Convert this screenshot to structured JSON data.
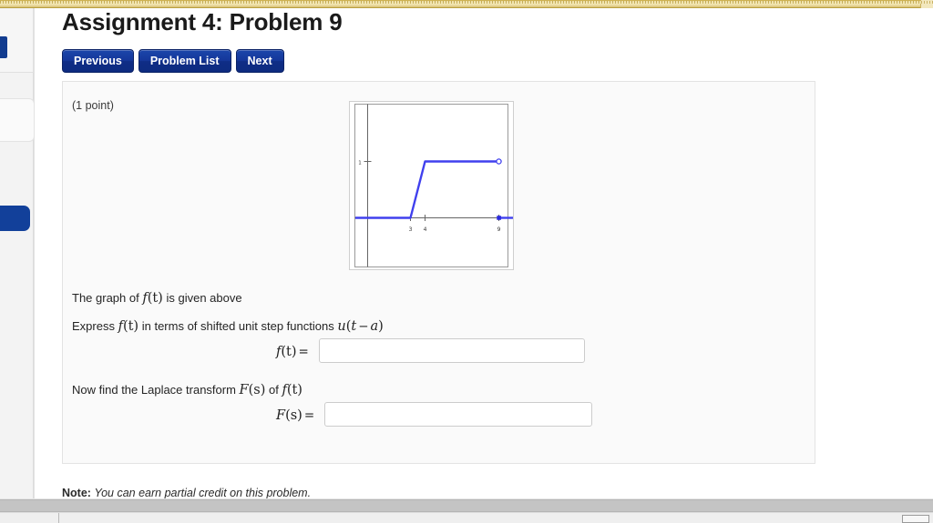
{
  "page": {
    "title": "Assignment 4: Problem 9",
    "points": "(1 point)",
    "note_label": "Note:",
    "note_text": "You can earn partial credit on this problem."
  },
  "nav": {
    "buttons": [
      {
        "label": "Previous",
        "name": "previous-button"
      },
      {
        "label": "Problem List",
        "name": "problem-list-button"
      },
      {
        "label": "Next",
        "name": "next-button"
      }
    ]
  },
  "prose": {
    "line1": {
      "pre": "The graph of ",
      "fn": "f",
      "fn_arg": "(t)",
      "post": " is given above"
    },
    "line2": {
      "pre": "Express ",
      "fn": "f",
      "fn_arg": "(t)",
      "mid": " in terms of shifted unit step functions ",
      "u": "u",
      "u_arg_open": "(",
      "u_var": "t",
      "u_minus": "−",
      "u_a": "a",
      "u_arg_close": ")"
    },
    "line3": {
      "pre": "Now find the Laplace transform ",
      "F": "F",
      "F_arg": "(s)",
      "mid": " of ",
      "fn": "f",
      "fn_arg": "(t)"
    }
  },
  "answers": [
    {
      "name": "f-of-t-answer",
      "label_fn": "f",
      "label_arg": "(t)",
      "label_eq": "=",
      "value": "",
      "placeholder": ""
    },
    {
      "name": "F-of-s-answer",
      "label_fn": "F",
      "label_arg": "(s)",
      "label_eq": "=",
      "value": "",
      "placeholder": ""
    }
  ],
  "colors": {
    "button_blue": "#12379a",
    "curve_blue": "#4040ee",
    "axis_gray": "#666666",
    "top_band_gold": "#e2cf83",
    "card_bg": "#fafafa"
  },
  "chart_data": {
    "type": "line",
    "title": "",
    "xlabel": "",
    "ylabel": "",
    "xlim": [
      -1.6,
      11.2
    ],
    "ylim": [
      -1.35,
      2.05
    ],
    "grid": false,
    "legend": null,
    "xticks": [
      3,
      4,
      9
    ],
    "xtick_labels": [
      "3",
      "4",
      "9"
    ],
    "yticks": [
      1
    ],
    "ytick_labels": [
      "1"
    ],
    "series": [
      {
        "name": "f(t)",
        "color": "#4040ee",
        "points": [
          {
            "x": -1.6,
            "y": 0
          },
          {
            "x": 3,
            "y": 0
          },
          {
            "x": 4,
            "y": 1
          },
          {
            "x": 9,
            "y": 1
          },
          {
            "x": 9,
            "y": 0
          },
          {
            "x": 11.2,
            "y": 0
          }
        ]
      }
    ],
    "markers": [
      {
        "x": 9,
        "y": 1,
        "style": "open-circle",
        "color": "#4040ee"
      },
      {
        "x": 9,
        "y": 0,
        "style": "filled-square",
        "color": "#4040ee"
      }
    ],
    "description": "Piecewise f(t): 0 for t<3, linear ramp from 0 at t=3 up to 1 at t=4, constant 1 for 4<=t<9, then 0 for t>=9 (open circle at (9,1), filled point at (9,0))."
  }
}
